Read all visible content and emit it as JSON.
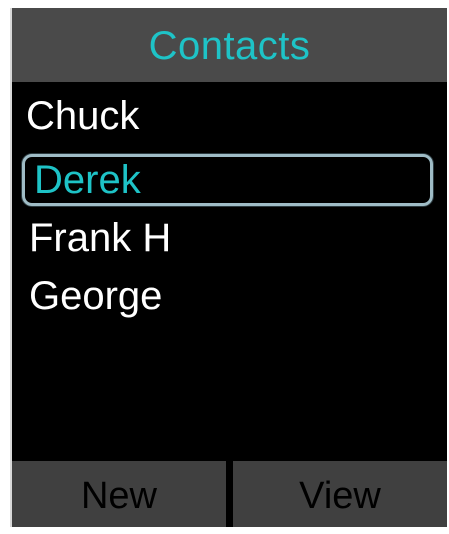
{
  "header": {
    "title": "Contacts"
  },
  "contacts": [
    {
      "name": "Chuck",
      "selected": false
    },
    {
      "name": "Derek",
      "selected": true
    },
    {
      "name": "Frank H",
      "selected": false
    },
    {
      "name": "George",
      "selected": false
    }
  ],
  "softkeys": {
    "left_label": "New",
    "right_label": "View"
  },
  "colors": {
    "accent": "#1ec3c7",
    "background": "#000000",
    "bar": "#4a4a4a",
    "highlight_border": "#9fbcc6"
  }
}
